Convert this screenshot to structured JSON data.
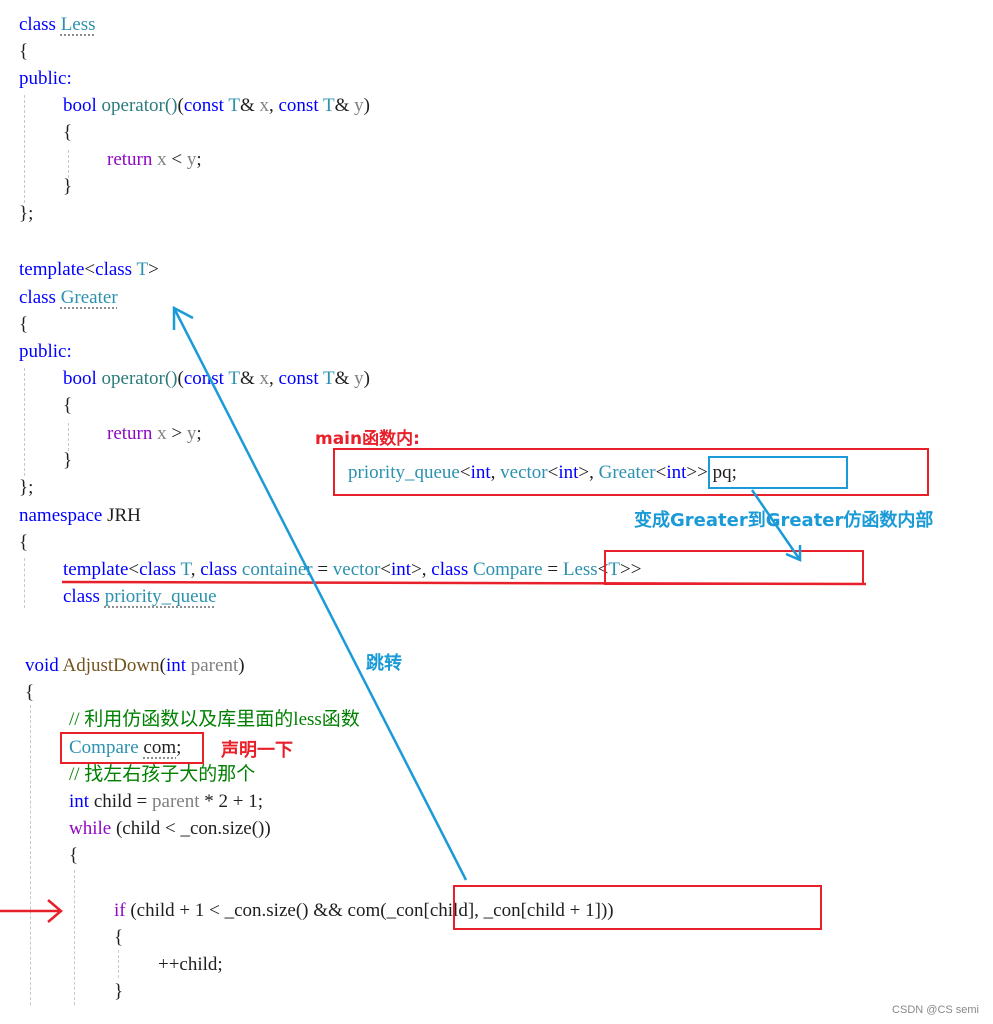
{
  "code_lines": {
    "l1": {
      "kw": "class",
      "name": "Less"
    },
    "l2": "{",
    "l3": "public:",
    "l4": {
      "ret": "bool",
      "fn": "operator()",
      "open": "(",
      "c1": "const",
      "t1": "T",
      "amp1": "&",
      "p1": "x",
      "comma": ", ",
      "c2": "const",
      "t2": "T",
      "amp2": "&",
      "p2": "y",
      "close": ")"
    },
    "l5": "{",
    "l6": {
      "kw": "return",
      "expr_a": "x",
      "op": "<",
      "expr_b": "y",
      "end": ";"
    },
    "l7": "}",
    "l8": "};",
    "l9": {
      "kw": "template",
      "lt": "<",
      "cls": "class",
      "t": "T",
      "gt": ">"
    },
    "l10": {
      "kw": "class",
      "name": "Greater"
    },
    "l11": "{",
    "l12": "public:",
    "l13": {
      "ret": "bool",
      "fn": "operator()",
      "open": "(",
      "c1": "const",
      "t1": "T",
      "amp1": "&",
      "p1": "x",
      "comma": ", ",
      "c2": "const",
      "t2": "T",
      "amp2": "&",
      "p2": "y",
      "close": ")"
    },
    "l14": "{",
    "l15": {
      "kw": "return",
      "expr_a": "x",
      "op": ">",
      "expr_b": "y",
      "end": ";"
    },
    "l16": "}",
    "l17": "};",
    "l18": {
      "kw": "namespace",
      "name": "JRH"
    },
    "l19": "{",
    "l20": {
      "tpl": "template",
      "lt": "<",
      "cls1": "class",
      "t": "T",
      "sep1": ", ",
      "cls2": "class",
      "container": "container",
      "eq1": " = ",
      "vector": "vector",
      "lt2": "<",
      "int": "int",
      "gt2": ">",
      "sep2": ", ",
      "cls3": "class",
      "compare": "Compare",
      "eq2": " = ",
      "less": "Less",
      "lt3": "<",
      "t3": "T",
      "gt3": ">",
      "gt": ">"
    },
    "l21": {
      "kw": "class",
      "name": "priority_queue"
    },
    "l22": {
      "kw": "void",
      "fn": "AdjustDown",
      "open": "(",
      "int": "int",
      "param": "parent",
      "close": ")"
    },
    "l23": "{",
    "l24": "// 利用仿函数以及库里面的less函数",
    "l25": {
      "type": "Compare",
      "var": "com",
      "end": ";"
    },
    "l26": "// 找左右孩子大的那个",
    "l27": {
      "int": "int",
      "rest1": " child = ",
      "param": "parent",
      "rest2": " * 2 + 1;"
    },
    "l28": {
      "kw": "while",
      "rest": " (child < _con.size())"
    },
    "l29": "{",
    "l30": {
      "kw": "if",
      "rest": " (child + 1 < _con.size() && ",
      "call": "com(_con[child], _con[child + 1])",
      "close": ")"
    },
    "l31": "{",
    "l32": "++child;",
    "l33": "}"
  },
  "main_snippet": {
    "pq": "priority_queue",
    "lt1": "<",
    "int1": "int",
    "sep1": ", ",
    "vector": "vector",
    "lt2": "<",
    "int2": "int",
    "gt2": ">",
    "sep2": ", ",
    "greater": "Greater",
    "lt3": "<",
    "int3": "int",
    "gt3": ">",
    "gt1": ">",
    "var": " pq;"
  },
  "annotations": {
    "main_label": "main函数内:",
    "becomes_label": "变成Greater到Greater仿函数内部",
    "jump_label": "跳转",
    "declare_label": "声明一下"
  },
  "colors": {
    "annotation_red": "#e8202a",
    "annotation_blue": "#1a9bd7",
    "keyword": "#0000ff",
    "type": "#2b91af",
    "control": "#8f08c4",
    "comment": "#008000"
  },
  "watermark": "CSDN @CS semi"
}
